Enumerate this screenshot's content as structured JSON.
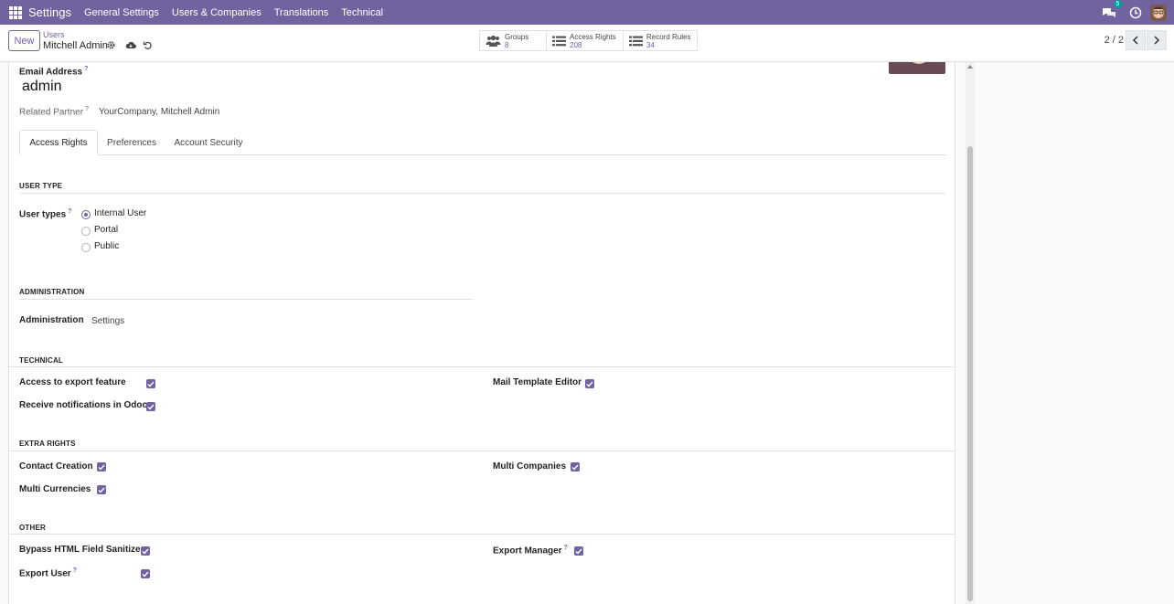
{
  "navbar": {
    "brand": "Settings",
    "menu": [
      "General Settings",
      "Users & Companies",
      "Translations",
      "Technical"
    ],
    "chat_badge": "5",
    "colors": {
      "bar": "#71639e"
    }
  },
  "control": {
    "new_label": "New",
    "breadcrumb_parent": "Users",
    "breadcrumb_current": "Mitchell Admin",
    "smart_buttons": [
      {
        "label": "Groups",
        "value": "8",
        "icon": "users-icon"
      },
      {
        "label": "Access Rights",
        "value": "208",
        "icon": "list-icon"
      },
      {
        "label": "Record Rules",
        "value": "34",
        "icon": "list-icon"
      }
    ],
    "pager": "2 / 2"
  },
  "form": {
    "email_label": "Email Address",
    "email_value": "admin",
    "partner_label": "Related Partner",
    "partner_value": "YourCompany, Mitchell Admin",
    "help_mark": "?",
    "tabs": [
      "Access Rights",
      "Preferences",
      "Account Security"
    ],
    "user_type": {
      "title": "USER TYPE",
      "label": "User types",
      "options": [
        "Internal User",
        "Portal",
        "Public"
      ],
      "selected": "Internal User"
    },
    "administration": {
      "title": "ADMINISTRATION",
      "label": "Administration",
      "value": "Settings"
    },
    "technical": {
      "title": "TECHNICAL",
      "items": [
        {
          "label": "Access to export feature",
          "checked": true
        },
        {
          "label": "Receive notifications in Odoo",
          "checked": true
        },
        {
          "label": "Mail Template Editor",
          "checked": true
        }
      ]
    },
    "extra_rights": {
      "title": "EXTRA RIGHTS",
      "items": [
        {
          "label": "Contact Creation",
          "checked": true
        },
        {
          "label": "Multi Currencies",
          "checked": true
        },
        {
          "label": "Multi Companies",
          "checked": true
        }
      ]
    },
    "other": {
      "title": "OTHER",
      "items": [
        {
          "label": "Bypass HTML Field Sanitize",
          "checked": true
        },
        {
          "label": "Export User",
          "checked": true
        },
        {
          "label": "Export Manager",
          "checked": true
        }
      ]
    }
  }
}
